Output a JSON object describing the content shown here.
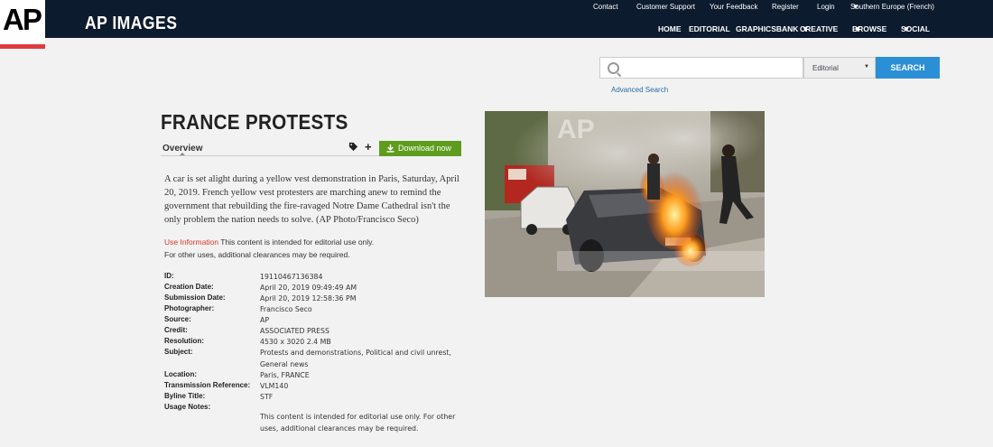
{
  "header": {
    "logo": "AP",
    "brand": "AP IMAGES",
    "util_nav": [
      "Contact",
      "Customer Support",
      "Your Feedback",
      "Register",
      "Login",
      "Southern Europe (French)"
    ],
    "main_nav": [
      "HOME",
      "EDITORIAL",
      "GRAPHICSBANK",
      "CREATIVE",
      "BROWSE",
      "SOCIAL"
    ]
  },
  "search": {
    "placeholder": "",
    "filter": "Editorial",
    "button": "SEARCH",
    "advanced": "Advanced Search"
  },
  "article": {
    "title": "FRANCE PROTESTS",
    "tab": "Overview",
    "download": "Download now",
    "caption": "A car is set alight during a yellow vest demonstration in Paris, Saturday, April 20, 2019. French yellow vest protesters are marching anew to remind the government that rebuilding the fire-ravaged Notre Dame Cathedral isn't the only problem the nation needs to solve. (AP Photo/Francisco Seco)",
    "use_info_label": "Use Information",
    "use_info_text1": "This content is intended for editorial use only.",
    "use_info_text2": "For other uses, additional clearances may be required."
  },
  "metadata": [
    {
      "key": "ID:",
      "value": "19110467136384"
    },
    {
      "key": "Creation Date:",
      "value": "April 20, 2019 09:49:49 AM"
    },
    {
      "key": "Submission Date:",
      "value": "April 20, 2019 12:58:36 PM"
    },
    {
      "key": "Photographer:",
      "value": "Francisco Seco"
    },
    {
      "key": "Source:",
      "value": "AP"
    },
    {
      "key": "Credit:",
      "value": "ASSOCIATED PRESS"
    },
    {
      "key": "Resolution:",
      "value": "4530 x 3020 2.4 MB"
    },
    {
      "key": "Subject:",
      "value": "Protests and demonstrations, Political and civil unrest, General news"
    },
    {
      "key": "Location:",
      "value": "Paris, FRANCE"
    },
    {
      "key": "Transmission Reference:",
      "value": "VLM140"
    },
    {
      "key": "Byline Title:",
      "value": "STF"
    },
    {
      "key": "Usage Notes:",
      "value": "This content is intended for editorial use only. For other uses, additional clearances may be required."
    }
  ],
  "photo": {
    "watermark": "AP"
  },
  "colors": {
    "header_bg": "#0d1b2e",
    "accent_red": "#e03a3e",
    "search_blue": "#2b8fd6",
    "download_green": "#5e9c1e"
  }
}
